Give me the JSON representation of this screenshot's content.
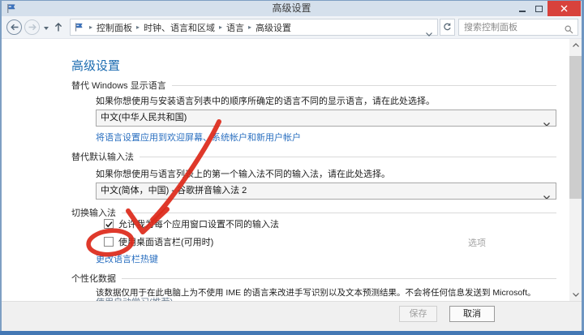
{
  "window": {
    "title": "高级设置"
  },
  "navbar": {
    "separator": "▸",
    "breadcrumb": [
      "控制面板",
      "时钟、语言和区域",
      "语言",
      "高级设置"
    ],
    "search_placeholder": "搜索控制面板"
  },
  "page": {
    "title": "高级设置",
    "sections": [
      {
        "header": "替代 Windows 显示语言",
        "description": "如果你想使用与安装语言列表中的顺序所确定的语言不同的显示语言，请在此处选择。",
        "dropdown_value": "中文(中华人民共和国)",
        "link": "将语言设置应用到欢迎屏幕、系统帐户和新用户帐户"
      },
      {
        "header": "替代默认输入法",
        "description": "如果你想使用与语言列表上的第一个输入法不同的输入法，请在此处选择。",
        "dropdown_value": "中文(简体，中国) - 谷歌拼音输入法 2"
      },
      {
        "header": "切换输入法",
        "checkbox_allow_label": "允许我为每个应用窗口设置不同的输入法",
        "checkbox_allow_checked": true,
        "checkbox_langbar_label": "使用桌面语言栏(可用时)",
        "checkbox_langbar_checked": false,
        "options_label": "选项",
        "hotkey_link": "更改语言栏热键"
      },
      {
        "header": "个性化数据",
        "description": "该数据仅用于在此电脑上为不使用 IME 的语言来改进手写识别以及文本预测结果。不会将任何信息发送到 Microsoft。",
        "clipped_line": "使用自动学习(推荐)"
      }
    ]
  },
  "footer": {
    "save_label": "保存",
    "cancel_label": "取消"
  },
  "colors": {
    "annotation_red": "#dd2a1b",
    "titlebar": "#d5e0ec",
    "bottom_border_blue": "#4478b4",
    "link_blue": "#2a6fc0",
    "heading_blue": "#1a6bb0",
    "close_button_red": "#d8423c"
  }
}
